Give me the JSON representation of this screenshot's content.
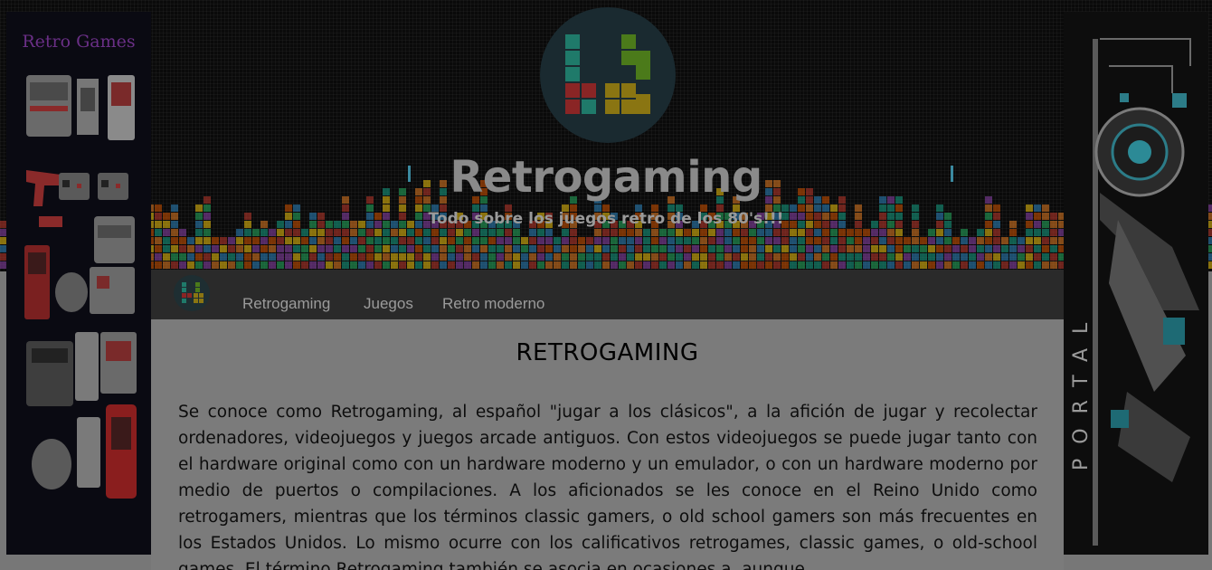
{
  "site": {
    "title": "Retrogaming",
    "subtitle": "Todo sobre los juegos retro de los 80's!!!"
  },
  "nav": {
    "items": [
      {
        "label": "Retrogaming"
      },
      {
        "label": "Juegos"
      },
      {
        "label": "Retro moderno"
      }
    ]
  },
  "article": {
    "heading": "RETROGAMING",
    "body": "Se conoce como Retrogaming, al español \"jugar a los clásicos\", a la afición de jugar y recolectar ordenadores, videojuegos y juegos arcade antiguos. Con estos videojuegos se puede jugar tanto con el hardware original como con un hardware moderno y un emulador, o con un hardware moderno por medio de puertos o compilaciones. A los aficionados se les conoce en el Reino Unido como retrogamers, mientras que los términos classic gamers, o old school gamers son más frecuentes en los Estados Unidos. Lo mismo ocurre con los calificativos retrogames, classic games, o old-school games. El término Retrogaming también se asocia en ocasiones a, aunque"
  },
  "ads": {
    "left_title": "Retro Games",
    "right_title": "PORTAL"
  },
  "colors": {
    "tetris": [
      "#c0392b",
      "#2e86c1",
      "#27ae60",
      "#f1c40f",
      "#8e44ad",
      "#e67e22",
      "#16a085",
      "#d35400"
    ]
  }
}
